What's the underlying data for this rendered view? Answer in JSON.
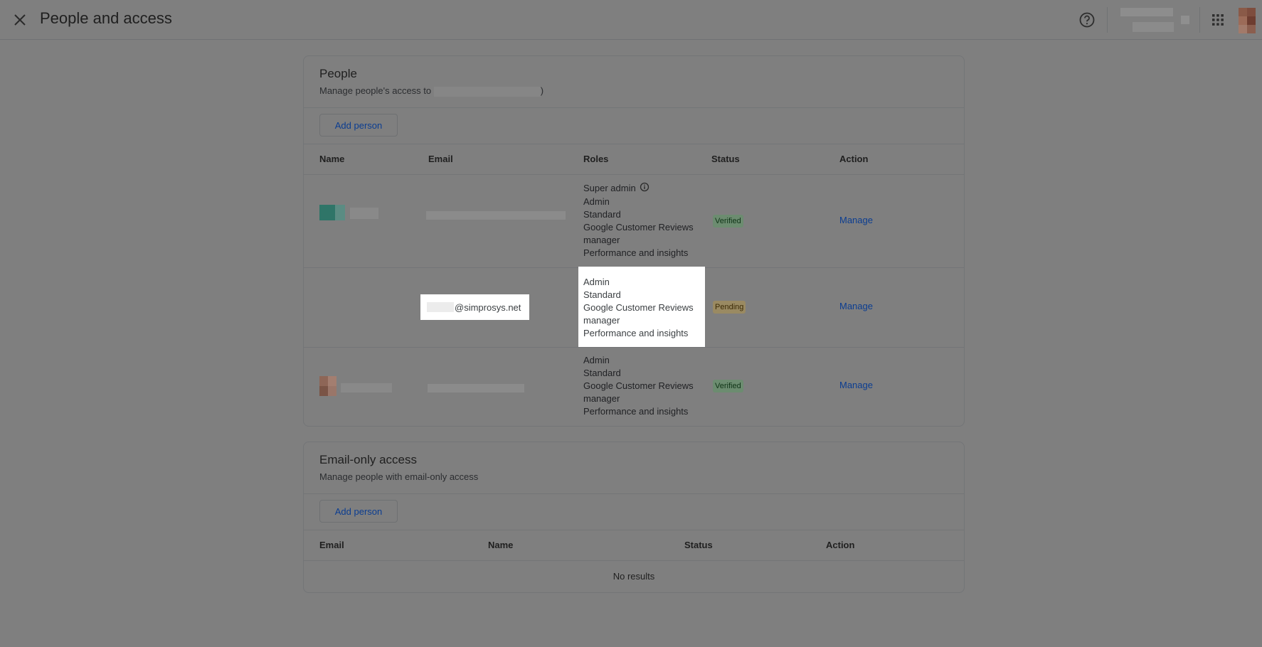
{
  "header": {
    "title": "People and access"
  },
  "people": {
    "title": "People",
    "subtitle_prefix": "Manage people's access to",
    "subtitle_suffix": ")",
    "add_button": "Add person",
    "columns": [
      "Name",
      "Email",
      "Roles",
      "Status",
      "Action"
    ],
    "rows": [
      {
        "roles": [
          "Super admin",
          "Admin",
          "Standard",
          "Google Customer Reviews",
          "manager",
          "Performance and insights"
        ],
        "status": "Verified",
        "action": "Manage"
      },
      {
        "email": "@simprosys.net",
        "roles": [
          "Admin",
          "Standard",
          "Google Customer Reviews",
          "manager",
          "Performance and insights"
        ],
        "status": "Pending",
        "action": "Manage"
      },
      {
        "roles": [
          "Admin",
          "Standard",
          "Google Customer Reviews",
          "manager",
          "Performance and insights"
        ],
        "status": "Verified",
        "action": "Manage"
      }
    ]
  },
  "email_only": {
    "title": "Email-only access",
    "subtitle": "Manage people with email-only access",
    "add_button": "Add person",
    "columns": [
      "Email",
      "Name",
      "Status",
      "Action"
    ],
    "empty": "No results"
  },
  "colors": {
    "overlay": "#7f7f7f",
    "link": "#0b3d91",
    "verified": "#6c8c70",
    "pending": "#9a8a62"
  }
}
